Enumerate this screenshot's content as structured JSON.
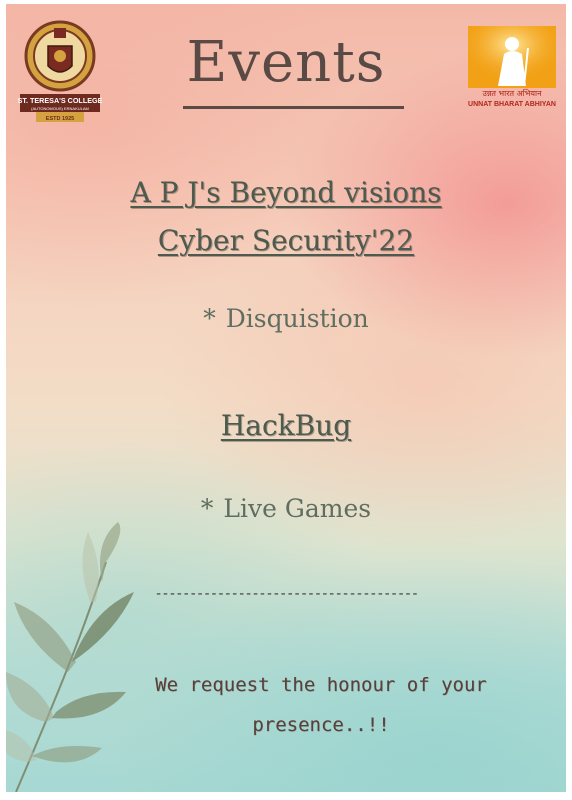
{
  "left_logo": {
    "top_text": "THE LIGHT OF THE SCHOOL",
    "college_name": "ST. TERESA'S COLLEGE",
    "subtitle": "(AUTONOMOUS) ERNAKULAM",
    "established": "ESTD 1925"
  },
  "right_logo": {
    "hindi_text": "उन्नत भारत अभियान",
    "english_text": "UNNAT BHARAT ABHIYAN"
  },
  "title": "Events",
  "heading_1": "A P J's Beyond visions",
  "heading_2": "Cyber Security'22",
  "item_1": {
    "star": "*",
    "label": "Disquistion"
  },
  "heading_3": "HackBug",
  "item_2": {
    "star": "*",
    "label": "Live Games"
  },
  "divider": "--------------------------------------",
  "request_line_1": "We request the honour of your",
  "request_line_2": "presence..!!",
  "colors": {
    "title": "#5a4a45",
    "heading": "#4d5a4e",
    "bullet": "#5f6e60",
    "request": "#5a3f3a",
    "logo_maroon": "#6e2a1f",
    "logo_gold": "#d6a640",
    "logo_orange": "#f2a116"
  },
  "icons": [
    "college-emblem-icon",
    "unnat-bharat-abhiyan-emblem-icon",
    "leaves-decoration-icon"
  ]
}
